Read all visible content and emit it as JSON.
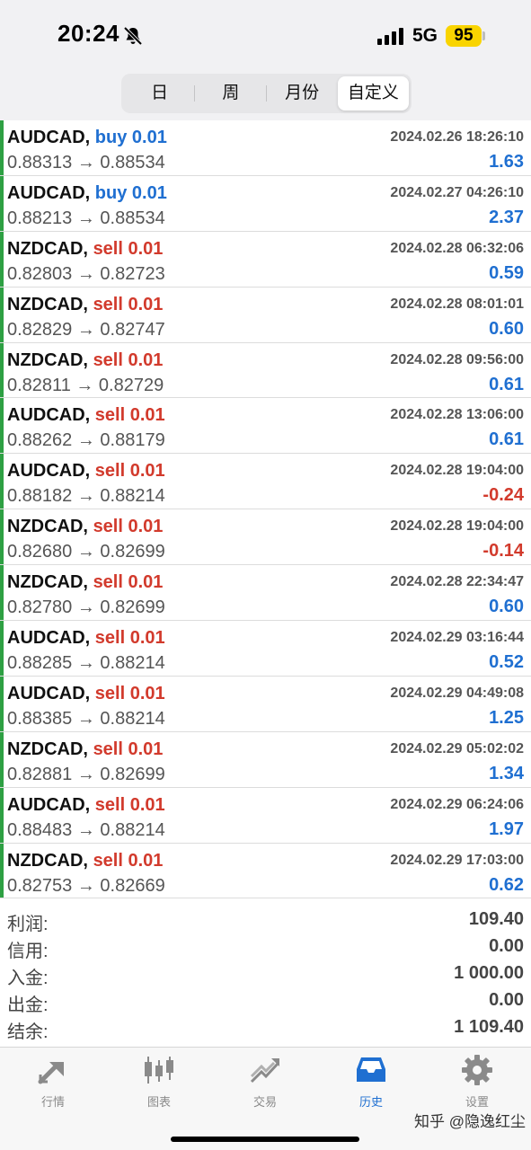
{
  "status_bar": {
    "time": "20:24",
    "network": "5G",
    "battery": "95"
  },
  "period_tabs": [
    {
      "label": "日",
      "active": false
    },
    {
      "label": "周",
      "active": false
    },
    {
      "label": "月份",
      "active": false
    },
    {
      "label": "自定义",
      "active": true
    }
  ],
  "trades": [
    {
      "symbol": "AUDCAD,",
      "side": "buy 0.01",
      "direction": "buy",
      "datetime": "2024.02.26 18:26:10",
      "prices": "0.88313 → 0.88534",
      "profit": "1.63"
    },
    {
      "symbol": "AUDCAD,",
      "side": "buy 0.01",
      "direction": "buy",
      "datetime": "2024.02.27 04:26:10",
      "prices": "0.88213 → 0.88534",
      "profit": "2.37"
    },
    {
      "symbol": "NZDCAD,",
      "side": "sell 0.01",
      "direction": "sell",
      "datetime": "2024.02.28 06:32:06",
      "prices": "0.82803 → 0.82723",
      "profit": "0.59"
    },
    {
      "symbol": "NZDCAD,",
      "side": "sell 0.01",
      "direction": "sell",
      "datetime": "2024.02.28 08:01:01",
      "prices": "0.82829 → 0.82747",
      "profit": "0.60"
    },
    {
      "symbol": "NZDCAD,",
      "side": "sell 0.01",
      "direction": "sell",
      "datetime": "2024.02.28 09:56:00",
      "prices": "0.82811 → 0.82729",
      "profit": "0.61"
    },
    {
      "symbol": "AUDCAD,",
      "side": "sell 0.01",
      "direction": "sell",
      "datetime": "2024.02.28 13:06:00",
      "prices": "0.88262 → 0.88179",
      "profit": "0.61"
    },
    {
      "symbol": "AUDCAD,",
      "side": "sell 0.01",
      "direction": "sell",
      "datetime": "2024.02.28 19:04:00",
      "prices": "0.88182 → 0.88214",
      "profit": "-0.24"
    },
    {
      "symbol": "NZDCAD,",
      "side": "sell 0.01",
      "direction": "sell",
      "datetime": "2024.02.28 19:04:00",
      "prices": "0.82680 → 0.82699",
      "profit": "-0.14"
    },
    {
      "symbol": "NZDCAD,",
      "side": "sell 0.01",
      "direction": "sell",
      "datetime": "2024.02.28 22:34:47",
      "prices": "0.82780 → 0.82699",
      "profit": "0.60"
    },
    {
      "symbol": "AUDCAD,",
      "side": "sell 0.01",
      "direction": "sell",
      "datetime": "2024.02.29 03:16:44",
      "prices": "0.88285 → 0.88214",
      "profit": "0.52"
    },
    {
      "symbol": "AUDCAD,",
      "side": "sell 0.01",
      "direction": "sell",
      "datetime": "2024.02.29 04:49:08",
      "prices": "0.88385 → 0.88214",
      "profit": "1.25"
    },
    {
      "symbol": "NZDCAD,",
      "side": "sell 0.01",
      "direction": "sell",
      "datetime": "2024.02.29 05:02:02",
      "prices": "0.82881 → 0.82699",
      "profit": "1.34"
    },
    {
      "symbol": "AUDCAD,",
      "side": "sell 0.01",
      "direction": "sell",
      "datetime": "2024.02.29 06:24:06",
      "prices": "0.88483 → 0.88214",
      "profit": "1.97"
    },
    {
      "symbol": "NZDCAD,",
      "side": "sell 0.01",
      "direction": "sell",
      "datetime": "2024.02.29 17:03:00",
      "prices": "0.82753 → 0.82669",
      "profit": "0.62"
    }
  ],
  "summary": [
    {
      "label": "利润:",
      "value": "109.40"
    },
    {
      "label": "信用:",
      "value": "0.00"
    },
    {
      "label": "入金:",
      "value": "1 000.00"
    },
    {
      "label": "出金:",
      "value": "0.00"
    },
    {
      "label": "结余:",
      "value": "1 109.40"
    }
  ],
  "tabbar": [
    {
      "label": "行情",
      "icon": "quotes-arrows-icon",
      "active": false
    },
    {
      "label": "图表",
      "icon": "candlestick-icon",
      "active": false
    },
    {
      "label": "交易",
      "icon": "trade-trend-icon",
      "active": false
    },
    {
      "label": "历史",
      "icon": "history-inbox-icon",
      "active": true
    },
    {
      "label": "设置",
      "icon": "gear-icon",
      "active": false
    }
  ],
  "watermark": "知乎 @隐逸红尘",
  "colors": {
    "buy": "#1f6fd1",
    "sell": "#d23a2c",
    "profit_positive": "#1f6fd1",
    "profit_negative": "#d23a2c",
    "row_indicator": "#2ea043",
    "active_tab": "#1f6fd1",
    "inactive_tab": "#8a8a8a",
    "battery": "#f9d400"
  }
}
